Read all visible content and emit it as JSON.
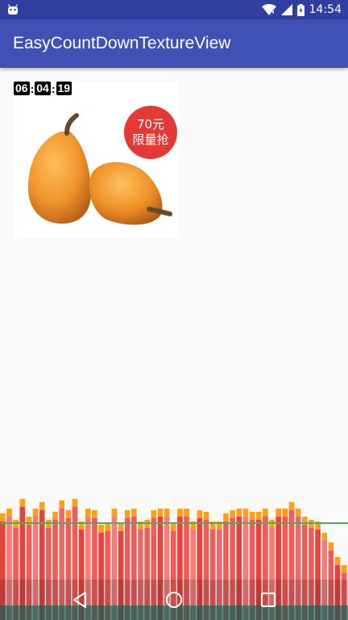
{
  "status_bar": {
    "time": "14:54",
    "icons": [
      "android-icon",
      "wifi-icon",
      "signal-icon",
      "battery-charging-icon"
    ]
  },
  "app_bar": {
    "title": "EasyCountDownTextureView"
  },
  "product": {
    "countdown": {
      "hours": "06",
      "minutes": "04",
      "seconds": "19"
    },
    "badge": {
      "price": "70元",
      "label": "限量抢"
    },
    "image": "loquat-fruit-image"
  },
  "navigation_bar": {
    "buttons": [
      "back-icon",
      "home-icon",
      "recents-icon"
    ]
  },
  "colors": {
    "status_bar": "#303f9f",
    "app_bar": "#3f51b5",
    "background": "#fafafa",
    "badge": "#e53935",
    "profile_threshold": "#4caf50"
  }
}
